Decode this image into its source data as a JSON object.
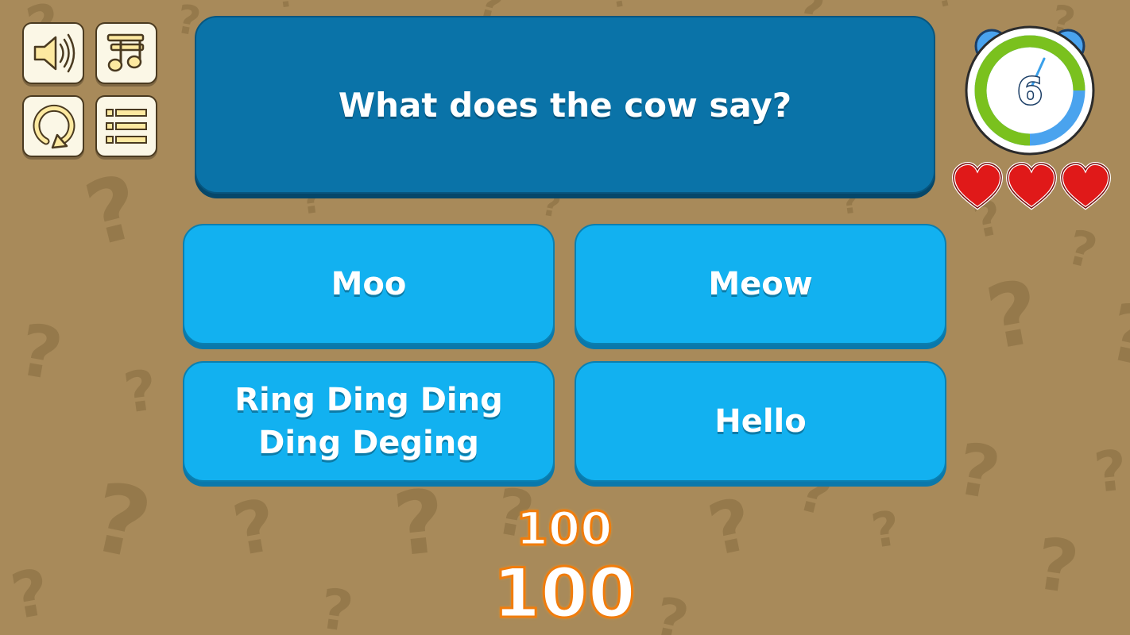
{
  "controls": [
    {
      "name": "sound-button",
      "icon": "speaker-icon"
    },
    {
      "name": "music-button",
      "icon": "music-note-icon"
    },
    {
      "name": "restart-button",
      "icon": "restart-icon"
    },
    {
      "name": "menu-button",
      "icon": "list-icon"
    }
  ],
  "question": {
    "text": "What does the cow say?"
  },
  "answers": [
    {
      "label": "Moo"
    },
    {
      "label": "Meow"
    },
    {
      "label": "Ring Ding Ding Ding Deging"
    },
    {
      "label": "Hello"
    }
  ],
  "timer": {
    "seconds": "6",
    "fraction_remaining": 0.75
  },
  "lives": {
    "count": 3
  },
  "score": {
    "round": "100",
    "total": "100"
  },
  "colors": {
    "background": "#a88a5a",
    "question_box": "#0a73a8",
    "answer_button": "#12b1f0",
    "heart": "#e01919",
    "score_outline": "#f07c0c"
  }
}
